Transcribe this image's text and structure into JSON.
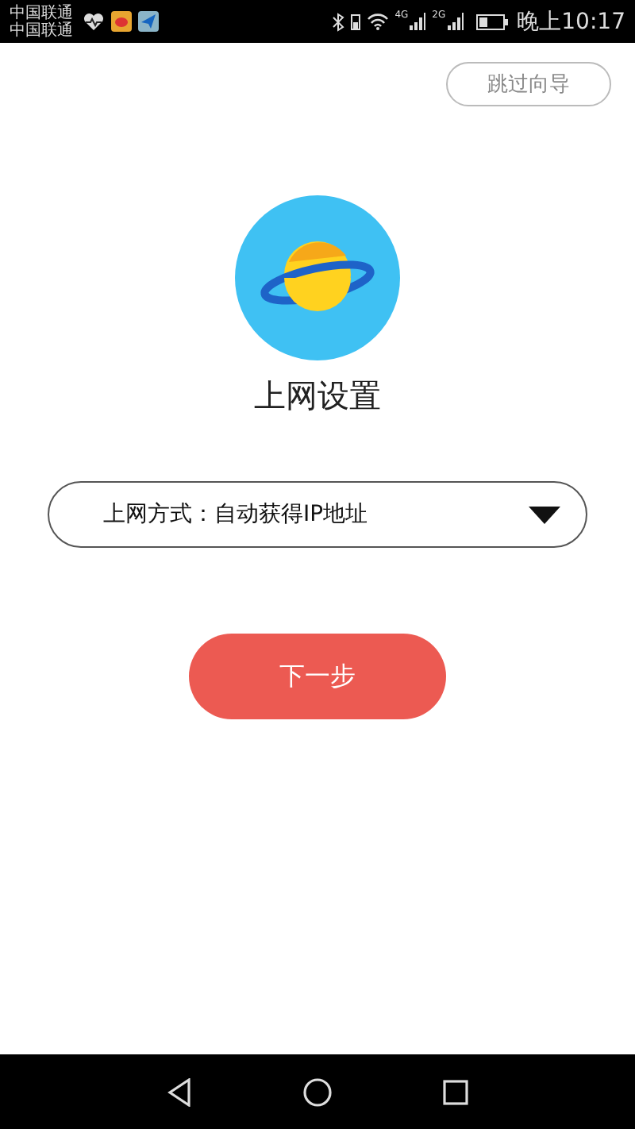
{
  "status_bar": {
    "carriers": [
      "中国联通",
      "中国联通"
    ],
    "network_labels": [
      "4G",
      "2G"
    ],
    "time": "晚上10:17"
  },
  "skip_button": "跳过向导",
  "title": "上网设置",
  "connection_select": {
    "value": "上网方式：自动获得IP地址"
  },
  "next_button": "下一步"
}
